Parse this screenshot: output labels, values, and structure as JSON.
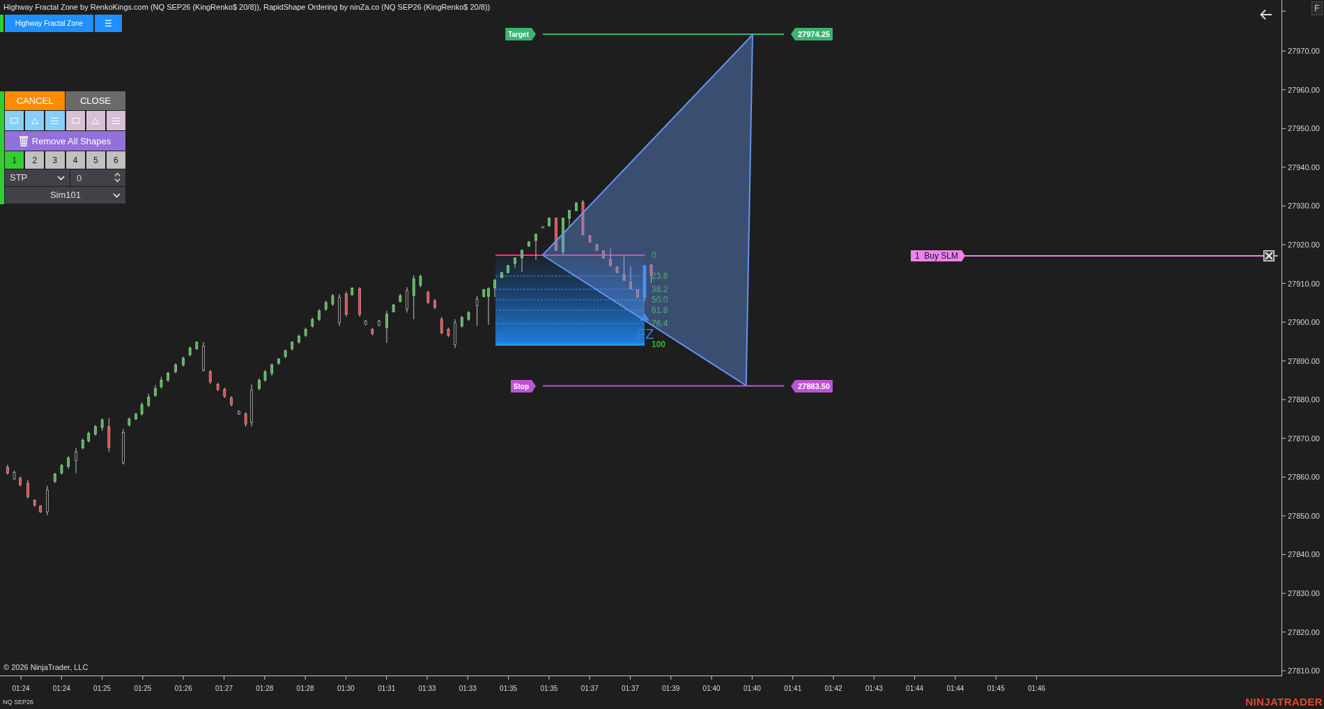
{
  "window": {
    "title": "Highway Fractal Zone by RenkoKings.com (NQ SEP26 (KingRenko$ 20/8)), RapidShape Ordering by ninZa.co (NQ SEP26 (KingRenko$ 20/8))"
  },
  "indicator_toolbar": {
    "buttons": [
      {
        "kind": "indicator",
        "label": "Highway Fractal Zone"
      },
      {
        "kind": "menu",
        "label": "☰"
      }
    ]
  },
  "order_panel": {
    "actions": [
      {
        "kind": "cancel",
        "label": "CANCEL"
      },
      {
        "kind": "close",
        "label": "CLOSE"
      }
    ],
    "shape_tools": [
      {
        "kind": "rectangle",
        "color": "#87cefa"
      },
      {
        "kind": "triangle",
        "color": "#87cefa"
      },
      {
        "kind": "lines",
        "color": "#87cefa"
      },
      {
        "kind": "rectangle",
        "color": "#d8bfd8"
      },
      {
        "kind": "triangle",
        "color": "#d8bfd8"
      },
      {
        "kind": "lines",
        "color": "#d8bfd8"
      }
    ],
    "remove_all": {
      "label": "Remove All Shapes"
    },
    "quantities": [
      {
        "label": "1",
        "selected": true
      },
      {
        "label": "2",
        "selected": false
      },
      {
        "label": "3",
        "selected": false
      },
      {
        "label": "4",
        "selected": false
      },
      {
        "label": "5",
        "selected": false
      },
      {
        "label": "6",
        "selected": false
      }
    ],
    "order_type": {
      "value": "STP"
    },
    "offset": {
      "value": "0"
    },
    "account": {
      "value": "Sim101"
    }
  },
  "chart": {
    "price_levels": [
      {
        "kind": "target",
        "label": "Target",
        "price": "27974.25"
      },
      {
        "kind": "stop",
        "label": "Stop",
        "price": "27883.50"
      }
    ],
    "fractal_zone": {
      "marker": "FZ",
      "levels": [
        {
          "label": "0",
          "color": "#4caf6e"
        },
        {
          "label": "23.6",
          "color": "#4caf6e"
        },
        {
          "label": "38.2",
          "color": "#4caf6e"
        },
        {
          "label": "50.0",
          "color": "#4caf6e"
        },
        {
          "label": "61.8",
          "color": "#4caf6e"
        },
        {
          "label": "76.4",
          "color": "#4caf6e"
        },
        {
          "label": "100",
          "color": "#22c022"
        }
      ]
    },
    "order": {
      "label": "1  Buy SLM"
    },
    "price_axis": {
      "labels": [
        "27970.00",
        "27960.00",
        "27950.00",
        "27940.00",
        "27930.00",
        "27920.00",
        "27910.00",
        "27900.00",
        "27890.00",
        "27880.00",
        "27870.00",
        "27860.00",
        "27850.00",
        "27840.00",
        "27830.00",
        "27820.00",
        "27810.00"
      ]
    },
    "time_axis": {
      "labels": [
        "01:24",
        "01:24",
        "01:25",
        "01:25",
        "01:26",
        "01:27",
        "01:28",
        "01:28",
        "01:30",
        "01:31",
        "01:33",
        "01:33",
        "01:35",
        "01:35",
        "01:37",
        "01:37",
        "01:39",
        "01:40",
        "01:40",
        "01:41",
        "01:42",
        "01:43",
        "01:44",
        "01:44",
        "01:45",
        "01:46"
      ]
    },
    "copyright": "© 2026 NinjaTrader, LLC"
  },
  "status_bar": {
    "instrument": "NQ SEP26",
    "logo": "NINJATRADER"
  },
  "corner_button": {
    "label": "F"
  }
}
